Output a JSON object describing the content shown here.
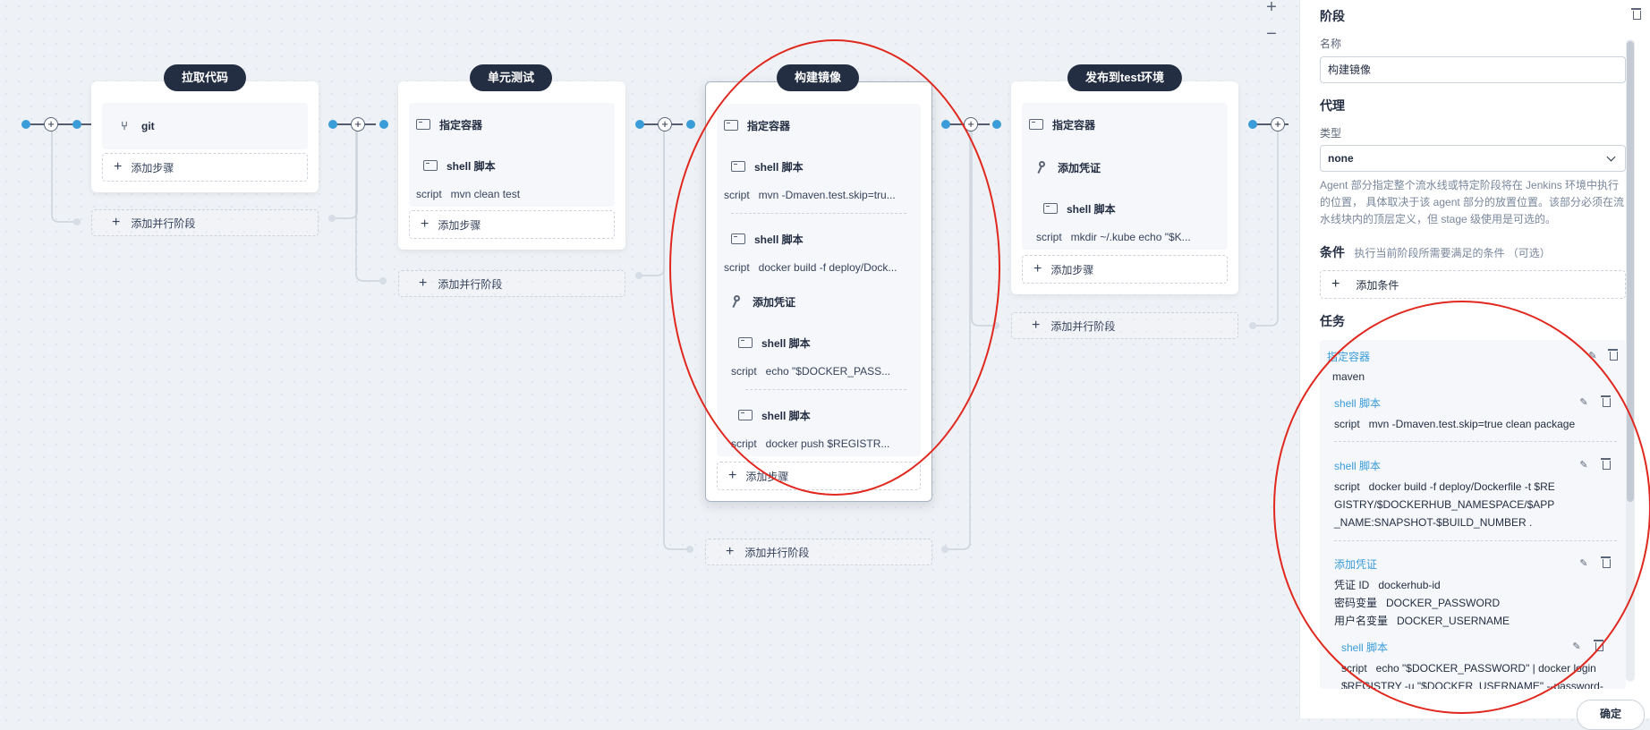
{
  "zoom": {
    "in": "+",
    "out": "−"
  },
  "stages": [
    {
      "title": "拉取代码",
      "steps": [
        {
          "icon": "git-icon",
          "label": "git"
        }
      ],
      "add_step": "添加步骤",
      "add_parallel": "添加并行阶段"
    },
    {
      "title": "单元测试",
      "container": "指定容器",
      "steps": [
        {
          "label": "shell 脚本",
          "key": "script",
          "value": "mvn clean test"
        }
      ],
      "add_step": "添加步骤",
      "add_parallel": "添加并行阶段"
    },
    {
      "title": "构建镜像",
      "container": "指定容器",
      "steps": [
        {
          "label": "shell 脚本",
          "key": "script",
          "value": "mvn -Dmaven.test.skip=tru..."
        },
        {
          "label": "shell 脚本",
          "key": "script",
          "value": "docker build -f deploy/Dock..."
        }
      ],
      "credential": "添加凭证",
      "cred_steps": [
        {
          "label": "shell 脚本",
          "key": "script",
          "value": "echo \"$DOCKER_PASS..."
        },
        {
          "label": "shell 脚本",
          "key": "script",
          "value": "docker push $REGISTR..."
        }
      ],
      "add_step": "添加步骤",
      "add_parallel": "添加并行阶段"
    },
    {
      "title": "发布到test环境",
      "container": "指定容器",
      "credential": "添加凭证",
      "cred_steps": [
        {
          "label": "shell 脚本",
          "key": "script",
          "value": "mkdir ~/.kube echo \"$K..."
        }
      ],
      "add_step": "添加步骤",
      "add_parallel": "添加并行阶段"
    }
  ],
  "panel": {
    "stage_title": "阶段",
    "name_label": "名称",
    "name_value": "构建镜像",
    "agent_title": "代理",
    "type_label": "类型",
    "type_value": "none",
    "agent_desc": "Agent 部分指定整个流水线或特定阶段将在 Jenkins 环境中执行的位置， 具体取决于该 agent 部分的放置位置。该部分必须在流水线块内的顶层定义，但 stage 级使用是可选的。",
    "cond_title": "条件",
    "cond_hint": "执行当前阶段所需要满足的条件 （可选）",
    "add_cond": "添加条件",
    "task_title": "任务",
    "tasks": {
      "container_link": "指定容器",
      "container_value": "maven",
      "shell1_link": "shell 脚本",
      "shell1_key": "script",
      "shell1_value": "mvn -Dmaven.test.skip=true clean package",
      "shell2_link": "shell 脚本",
      "shell2_key": "script",
      "shell2_value": "docker build -f deploy/Dockerfile -t $REGISTRY/$DOCKERHUB_NAMESPACE/$APP_NAME:SNAPSHOT-$BUILD_NUMBER .",
      "cred_link": "添加凭证",
      "cred_id_key": "凭证 ID",
      "cred_id_value": "dockerhub-id",
      "cred_pwd_key": "密码变量",
      "cred_pwd_value": "DOCKER_PASSWORD",
      "cred_user_key": "用户名变量",
      "cred_user_value": "DOCKER_USERNAME",
      "shell3_link": "shell 脚本",
      "shell3_key": "script",
      "shell3_value": "echo \"$DOCKER_PASSWORD\" | docker login $REGISTRY -u \"$DOCKER_USERNAME\" --password-"
    },
    "ok_button": "确定"
  },
  "colors": {
    "accent": "#3a9cd8",
    "title_bg": "#242e42",
    "annotation": "#e0281e"
  }
}
